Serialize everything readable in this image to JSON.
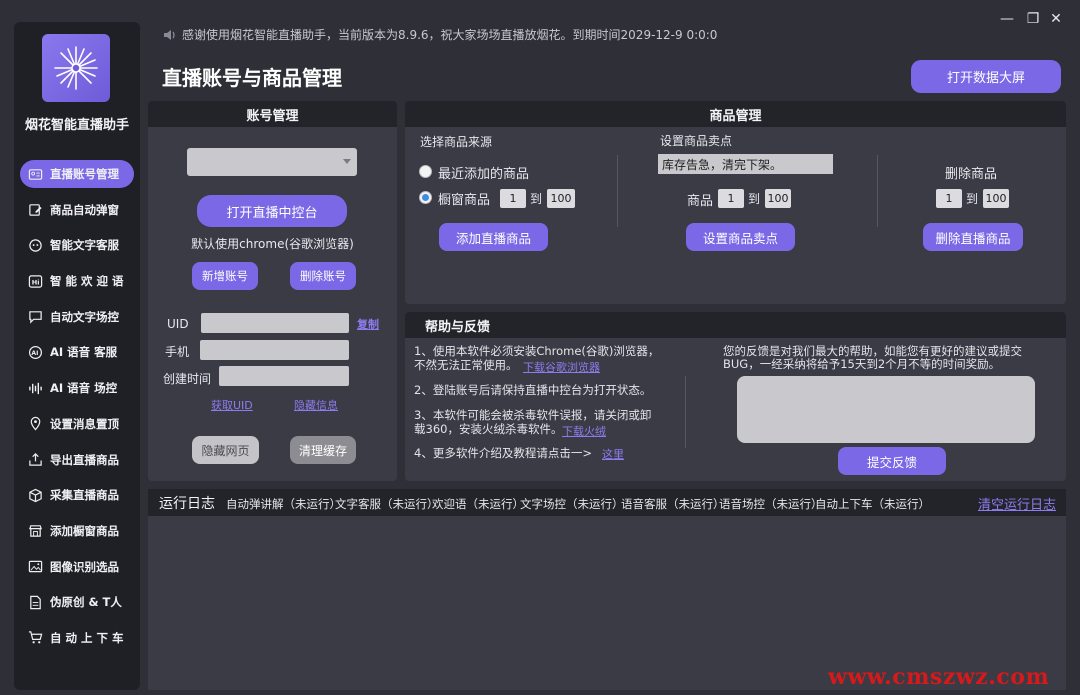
{
  "window": {
    "notice": "感谢使用烟花智能直播助手，当前版本为8.9.6，祝大家场场直播放烟花。到期时间2029-12-9 0:0:0",
    "controls": [
      "—",
      "❐",
      "✕"
    ]
  },
  "sidebar": {
    "app_name": "烟花智能直播助手",
    "items": [
      {
        "label": "直播账号管理",
        "icon": "id-card-icon",
        "active": true
      },
      {
        "label": "商品自动弹窗",
        "icon": "edit-icon"
      },
      {
        "label": "智能文字客服",
        "icon": "chat-bot-icon"
      },
      {
        "label": "智 能 欢 迎 语",
        "icon": "hi-icon"
      },
      {
        "label": "自动文字场控",
        "icon": "comment-icon"
      },
      {
        "label": "AI 语音 客服",
        "icon": "ai-icon"
      },
      {
        "label": "AI 语音 场控",
        "icon": "voice-wave-icon"
      },
      {
        "label": "设置消息置顶",
        "icon": "pin-icon"
      },
      {
        "label": "导出直播商品",
        "icon": "export-icon"
      },
      {
        "label": "采集直播商品",
        "icon": "box-icon"
      },
      {
        "label": "添加橱窗商品",
        "icon": "store-icon"
      },
      {
        "label": "图像识别选品",
        "icon": "image-icon"
      },
      {
        "label": "伪原创 & T人",
        "icon": "doc-edit-icon"
      },
      {
        "label": "自 动 上 下 车",
        "icon": "cart-icon"
      }
    ]
  },
  "header": {
    "title": "直播账号与商品管理",
    "open_dashboard": "打开数据大屏"
  },
  "account": {
    "panel_title": "账号管理",
    "account_select_value": "",
    "open_console": "打开直播中控台",
    "browser_note": "默认使用chrome(谷歌浏览器)",
    "add_account": "新增账号",
    "delete_account": "删除账号",
    "uid_label": "UID",
    "phone_label": "手机",
    "created_label": "创建时间",
    "uid_value": "",
    "phone_value": "",
    "created_value": "",
    "copy": "复制",
    "get_uid": "获取UID",
    "hide_info": "隐藏信息",
    "hide_page": "隐藏网页",
    "clear_cache": "清理缓存"
  },
  "product": {
    "panel_title": "商品管理",
    "source_label": "选择商品来源",
    "recent_option": "最近添加的商品",
    "window_option": "橱窗商品",
    "selected_source": "window",
    "range_from": "1",
    "range_to_word": "到",
    "range_to": "100",
    "add_button": "添加直播商品",
    "selling_label": "设置商品卖点",
    "selling_text": "库存告急，清完下架。",
    "goods_word": "商品",
    "sell_from": "1",
    "sell_to": "100",
    "set_selling_button": "设置商品卖点",
    "delete_label": "删除商品",
    "del_from": "1",
    "del_to": "100",
    "delete_button": "删除直播商品"
  },
  "help": {
    "panel_title": "帮助与反馈",
    "line1a": "1、使用本软件必须安装Chrome(谷歌)浏览器，",
    "line1b": "不然无法正常使用。",
    "line1_link": "下载谷歌浏览器",
    "line2": "2、登陆账号后请保持直播中控台为打开状态。",
    "line3a": "3、本软件可能会被杀毒软件误报，请关闭或卸",
    "line3b": "载360，安装火绒杀毒软件。",
    "line3_link": "下载火绒",
    "line4": "4、更多软件介绍及教程请点击一>",
    "line4_link": "这里",
    "feedback_a": "您的反馈是对我们最大的帮助，如能您有更好的建议或提交",
    "feedback_b": "BUG，一经采纳将给予15天到2个月不等的时间奖励。",
    "feedback_value": "",
    "submit": "提交反馈"
  },
  "log": {
    "title": "运行日志",
    "statuses": [
      "自动弹讲解（未运行）",
      "文字客服（未运行）",
      "欢迎语（未运行）",
      "文字场控（未运行）",
      "语音客服（未运行）",
      "语音场控（未运行）",
      "自动上下车（未运行）"
    ],
    "clear": "清空运行日志"
  },
  "watermark": "www.cmszwz.com",
  "colors": {
    "accent": "#7b68e6",
    "link": "#8c7cf0",
    "watermark": "#d6191b"
  }
}
